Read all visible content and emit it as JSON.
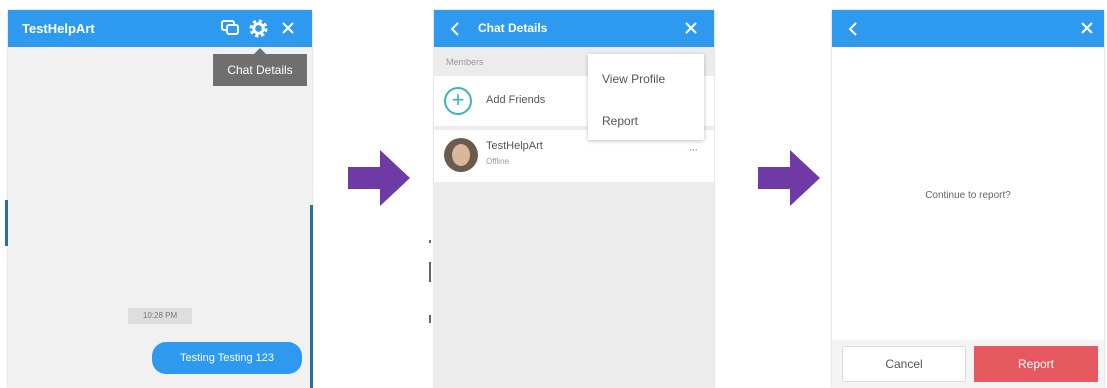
{
  "panel1": {
    "title": "TestHelpArt",
    "tooltip": "Chat Details",
    "timestamp": "10:28 PM",
    "message": "Testing Testing 123",
    "icons": [
      "chat-icon",
      "gear-icon",
      "close-icon"
    ]
  },
  "panel2": {
    "title": "Chat Details",
    "members_label": "Members",
    "add_friends": "Add Friends",
    "user": {
      "name": "TestHelpArt",
      "status": "Offline"
    },
    "more": "···",
    "menu": {
      "view_profile": "View Profile",
      "report": "Report"
    },
    "icons": [
      "back-icon",
      "close-icon",
      "add-icon"
    ]
  },
  "panel3": {
    "confirm_text": "Continue to report?",
    "cancel": "Cancel",
    "report": "Report",
    "icons": [
      "back-icon",
      "close-icon"
    ]
  },
  "colors": {
    "header": "#2d9af0",
    "arrow": "#6f3aa6",
    "report_button": "#e5585f",
    "add_icon": "#3ab5b8"
  }
}
